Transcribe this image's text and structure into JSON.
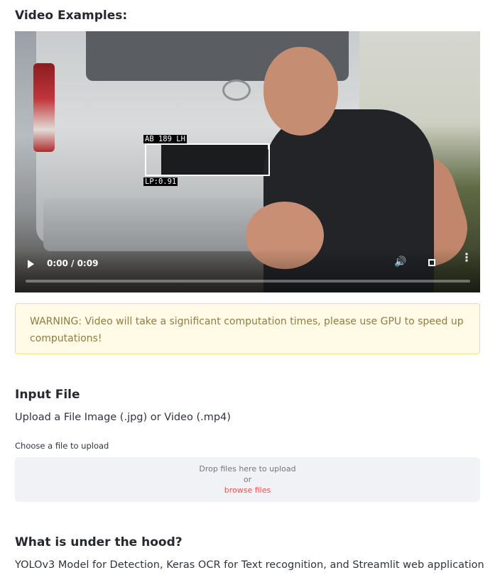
{
  "video_section": {
    "heading": "Video Examples:"
  },
  "video": {
    "detections": {
      "plate_text": "AB 189 LH",
      "confidence": "LP:0.91"
    },
    "time": "0:00 / 0:09",
    "progress": 0
  },
  "warning": {
    "text": "WARNING: Video will take a significant computation times, please use GPU to speed up computations!"
  },
  "input_section": {
    "heading": "Input File",
    "description": "Upload a File Image (.jpg) or Video (.mp4)",
    "uploader": {
      "label": "Choose a file to upload",
      "drop_text": "Drop files here to upload",
      "or_text": "or",
      "browse_text": "browse files"
    }
  },
  "hood_section": {
    "heading": "What is under the hood?",
    "description": "YOLOv3 Model for Detection, Keras OCR for Text recognition, and Streamlit web application"
  },
  "icons": {
    "play": "play-icon",
    "volume": "volume-icon",
    "fullscreen": "fullscreen-icon",
    "more": "more-vert-icon"
  },
  "colors": {
    "warning_bg": "#fffbe6",
    "warning_border": "#f3dd94",
    "warning_text": "#927b3e",
    "accent": "#ff4b4b",
    "dropzone_bg": "#f0f2f6"
  }
}
